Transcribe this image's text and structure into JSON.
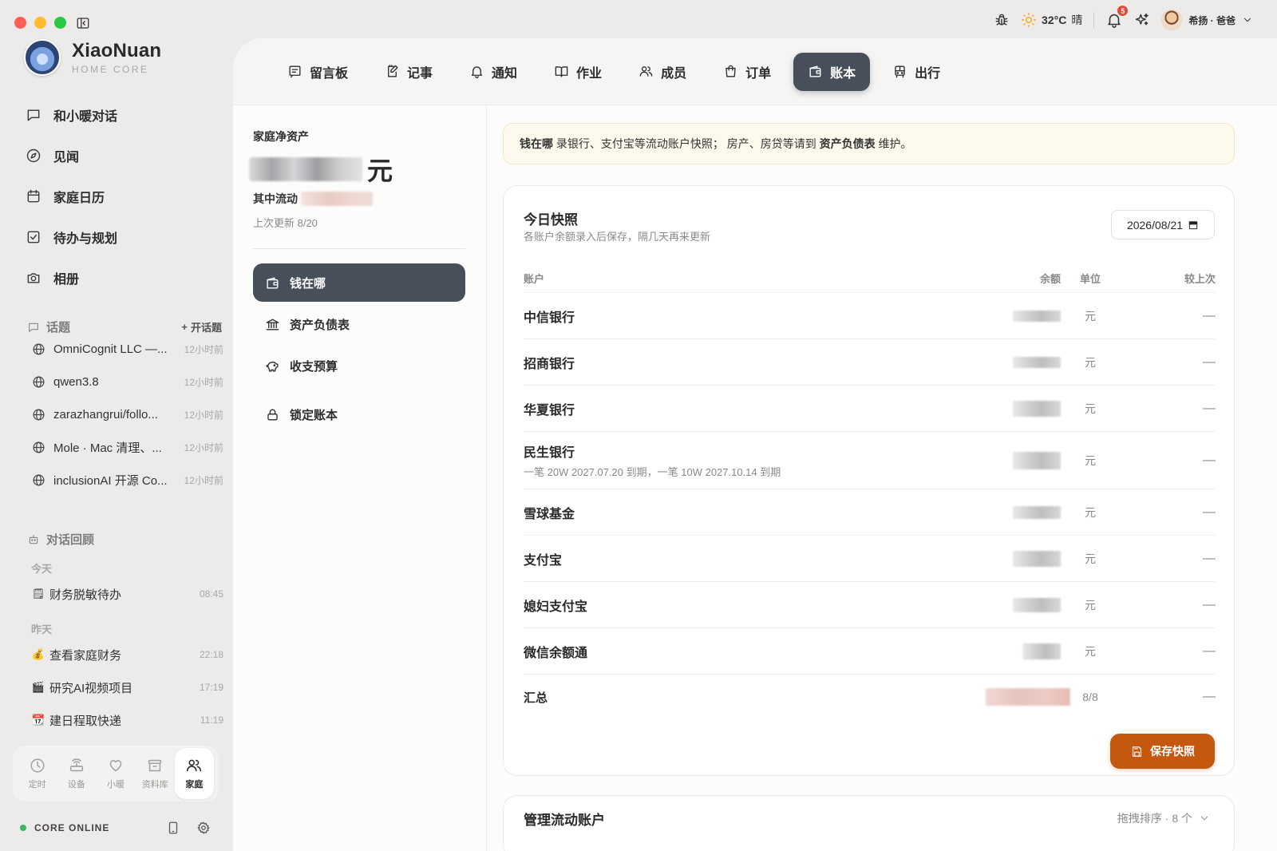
{
  "titlebar": {
    "weather": {
      "temp": "32°C",
      "condition": "晴"
    },
    "notification_count": "5",
    "user_name": "希扬 · 爸爸"
  },
  "brand": {
    "name": "XiaoNuan",
    "subtitle": "HOME CORE"
  },
  "sidebar": {
    "nav": [
      {
        "label": "和小暖对话",
        "icon": "chat-icon"
      },
      {
        "label": "见闻",
        "icon": "compass-icon"
      },
      {
        "label": "家庭日历",
        "icon": "calendar-icon"
      },
      {
        "label": "待办与规划",
        "icon": "checkbox-icon"
      },
      {
        "label": "相册",
        "icon": "camera-icon"
      }
    ],
    "topics_title": "话题",
    "topics_add": "开话题",
    "topics": [
      {
        "title": "OmniCognit LLC —...",
        "time": "12小时前"
      },
      {
        "title": "qwen3.8",
        "time": "12小时前"
      },
      {
        "title": "zarazhangrui/follo...",
        "time": "12小时前"
      },
      {
        "title": "Mole · Mac 清理、...",
        "time": "12小时前"
      },
      {
        "title": "inclusionAI 开源 Co...",
        "time": "12小时前"
      }
    ],
    "review_title": "对话回顾",
    "today_label": "今天",
    "yesterday_label": "昨天",
    "today_items": [
      {
        "emoji": "🗒",
        "title": "财务脱敏待办",
        "time": "08:45"
      }
    ],
    "yesterday_items": [
      {
        "emoji": "💰",
        "title": "查看家庭财务",
        "time": "22:18"
      },
      {
        "emoji": "🎬",
        "title": "研究AI视频项目",
        "time": "17:19"
      },
      {
        "emoji": "📆",
        "title": "建日程取快递",
        "time": "11:19"
      }
    ],
    "dock": [
      {
        "label": "定时",
        "icon": "clock-icon"
      },
      {
        "label": "设备",
        "icon": "router-icon"
      },
      {
        "label": "小暖",
        "icon": "heart-icon"
      },
      {
        "label": "资料库",
        "icon": "archive-icon"
      },
      {
        "label": "家庭",
        "icon": "family-icon"
      }
    ],
    "core_status": "CORE ONLINE"
  },
  "tabs": [
    {
      "label": "留言板",
      "icon": "message-board-icon"
    },
    {
      "label": "记事",
      "icon": "note-edit-icon"
    },
    {
      "label": "通知",
      "icon": "bell-icon"
    },
    {
      "label": "作业",
      "icon": "book-icon"
    },
    {
      "label": "成员",
      "icon": "members-icon"
    },
    {
      "label": "订单",
      "icon": "shopping-bag-icon"
    },
    {
      "label": "账本",
      "icon": "wallet-icon"
    },
    {
      "label": "出行",
      "icon": "bus-icon"
    }
  ],
  "ledger": {
    "net_worth_label": "家庭净资产",
    "net_worth_unit": "元",
    "liquid_label": "其中流动",
    "updated": "上次更新 8/20",
    "menu": [
      {
        "label": "钱在哪",
        "icon": "wallet-icon"
      },
      {
        "label": "资产负债表",
        "icon": "bank-icon"
      },
      {
        "label": "收支预算",
        "icon": "piggy-bank-icon"
      },
      {
        "label": "锁定账本",
        "icon": "lock-icon"
      }
    ]
  },
  "notice": {
    "bold1": "钱在哪",
    "text1": " 录银行、支付宝等流动账户快照； 房产、房贷等请到 ",
    "bold2": "资产负债表",
    "text2": " 维护。"
  },
  "snapshot": {
    "title": "今日快照",
    "subtitle": "各账户余额录入后保存，隔几天再来更新",
    "date": "2026/08/21",
    "columns": {
      "account": "账户",
      "balance": "余额",
      "unit": "单位",
      "compare": "较上次"
    },
    "rows": [
      {
        "name": "中信银行",
        "note": "",
        "unit": "元",
        "compare": "—"
      },
      {
        "name": "招商银行",
        "note": "",
        "unit": "元",
        "compare": "—"
      },
      {
        "name": "华夏银行",
        "note": "",
        "unit": "元",
        "compare": "—"
      },
      {
        "name": "民生银行",
        "note": "一笔 20W 2027.07.20 到期，一笔 10W 2027.10.14 到期",
        "unit": "元",
        "compare": "—"
      },
      {
        "name": "雪球基金",
        "note": "",
        "unit": "元",
        "compare": "—"
      },
      {
        "name": "支付宝",
        "note": "",
        "unit": "元",
        "compare": "—"
      },
      {
        "name": "媳妇支付宝",
        "note": "",
        "unit": "元",
        "compare": "—"
      },
      {
        "name": "微信余额通",
        "note": "",
        "unit": "元",
        "compare": "—"
      }
    ],
    "total": {
      "name": "汇总",
      "count": "8/8",
      "compare": "—"
    },
    "save_label": "保存快照"
  },
  "manage": {
    "title": "管理流动账户",
    "hint": "拖拽排序 · 8 个"
  }
}
